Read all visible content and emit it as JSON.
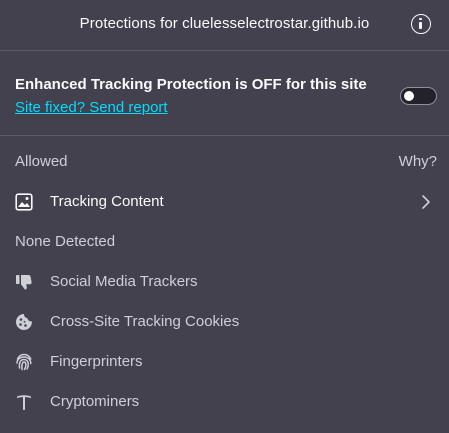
{
  "header": {
    "title": "Protections for cluelesselectrostar.github.io",
    "info_icon": "info-icon"
  },
  "etp": {
    "status_text": "Enhanced Tracking Protection is OFF for this site",
    "report_link": "Site fixed? Send report",
    "toggle_on": false
  },
  "allowed": {
    "label": "Allowed",
    "why_link": "Why?",
    "items": [
      {
        "label": "Tracking Content",
        "icon": "image-icon"
      }
    ]
  },
  "none_detected": {
    "label": "None Detected",
    "items": [
      {
        "label": "Social Media Trackers",
        "icon": "thumbs-down-icon"
      },
      {
        "label": "Cross-Site Tracking Cookies",
        "icon": "cookie-icon"
      },
      {
        "label": "Fingerprinters",
        "icon": "fingerprint-icon"
      },
      {
        "label": "Cryptominers",
        "icon": "pickaxe-icon"
      }
    ]
  },
  "colors": {
    "background": "#42414d",
    "text": "#fbfbfe",
    "secondary_text": "#cfcfd8",
    "link": "#00ddff",
    "separator": "#5b5a65"
  }
}
